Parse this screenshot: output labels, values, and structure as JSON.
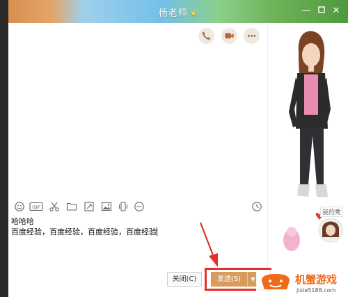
{
  "window": {
    "title": "杨老师",
    "title_badge_icon": "star-icon",
    "controls": [
      "minimize-icon",
      "maximize-icon",
      "close-icon"
    ]
  },
  "header_actions": [
    "phone-icon",
    "video-call-icon",
    "more-icon"
  ],
  "toolbar": {
    "items": [
      "emoji-icon",
      "gif-icon",
      "screenshot-icon",
      "folder-icon",
      "image-edit-icon",
      "picture-icon",
      "shake-icon",
      "more-icon",
      "history-icon"
    ],
    "gif_label": "GIF"
  },
  "compose": {
    "lines": [
      "哈哈哈",
      "百度经验，百度经验，百度经验，百度经验"
    ]
  },
  "buttons": {
    "close_label": "关闭(C)",
    "send_label": "发送(S)"
  },
  "right_panel": {
    "my_show_label": "我的秀"
  },
  "watermark": {
    "title": "机蟹游戏",
    "url": "jixie5188.com"
  },
  "colors": {
    "send_button": "#d89b5e",
    "highlight_outline": "#e5302a",
    "action_button_bg": "#efe8df",
    "watermark_brand": "#ee6b1a"
  }
}
